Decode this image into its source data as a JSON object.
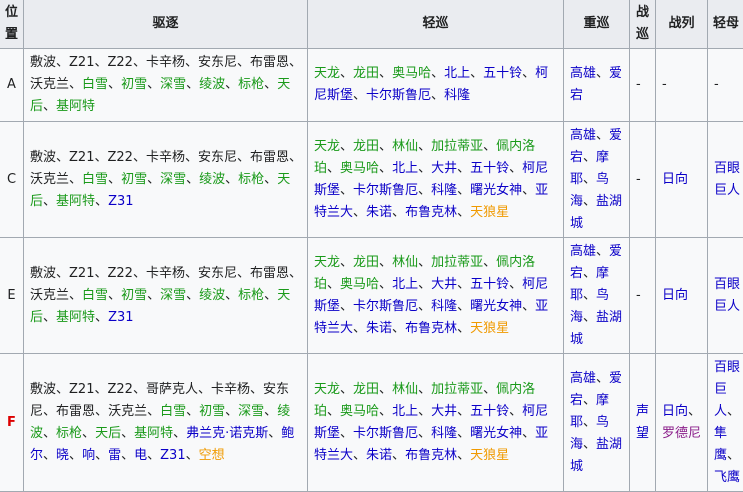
{
  "colors": {
    "black": "#202122",
    "green": "#1a9a1a",
    "blue": "#0b00c8",
    "orange": "#f09a00",
    "purple": "#8a1e8a",
    "red": "#dd0000"
  },
  "headers": [
    "位置",
    "驱逐",
    "轻巡",
    "重巡",
    "战巡",
    "战列",
    "轻母"
  ],
  "rows": [
    {
      "position": "A",
      "position_color": "black",
      "destroyers": [
        {
          "t": "敷波",
          "c": "black"
        },
        {
          "t": "Z21",
          "c": "black"
        },
        {
          "t": "Z22",
          "c": "black"
        },
        {
          "t": "卡辛杨",
          "c": "black"
        },
        {
          "t": "安东尼",
          "c": "black"
        },
        {
          "t": "布雷恩",
          "c": "black"
        },
        {
          "t": "沃克兰",
          "c": "black"
        },
        {
          "t": "白雪",
          "c": "green"
        },
        {
          "t": "初雪",
          "c": "green"
        },
        {
          "t": "深雪",
          "c": "green"
        },
        {
          "t": "绫波",
          "c": "green"
        },
        {
          "t": "标枪",
          "c": "green"
        },
        {
          "t": "天后",
          "c": "green"
        },
        {
          "t": "基阿特",
          "c": "green"
        }
      ],
      "light_cruisers": [
        {
          "t": "天龙",
          "c": "green"
        },
        {
          "t": "龙田",
          "c": "green"
        },
        {
          "t": "奥马哈",
          "c": "green"
        },
        {
          "t": "北上",
          "c": "blue"
        },
        {
          "t": "五十铃",
          "c": "blue"
        },
        {
          "t": "柯尼斯堡",
          "c": "blue"
        },
        {
          "t": "卡尔斯鲁厄",
          "c": "blue"
        },
        {
          "t": "科隆",
          "c": "blue"
        }
      ],
      "heavy_cruisers": [
        {
          "t": "高雄",
          "c": "blue"
        },
        {
          "t": "爱宕",
          "c": "blue"
        }
      ],
      "battlecruisers": [
        {
          "t": "-",
          "c": "black"
        }
      ],
      "battleships": [
        {
          "t": "-",
          "c": "black"
        }
      ],
      "light_carriers": [
        {
          "t": "-",
          "c": "black"
        }
      ]
    },
    {
      "position": "C",
      "position_color": "black",
      "destroyers": [
        {
          "t": "敷波",
          "c": "black"
        },
        {
          "t": "Z21",
          "c": "black"
        },
        {
          "t": "Z22",
          "c": "black"
        },
        {
          "t": "卡辛杨",
          "c": "black"
        },
        {
          "t": "安东尼",
          "c": "black"
        },
        {
          "t": "布雷恩",
          "c": "black"
        },
        {
          "t": "沃克兰",
          "c": "black"
        },
        {
          "t": "白雪",
          "c": "green"
        },
        {
          "t": "初雪",
          "c": "green"
        },
        {
          "t": "深雪",
          "c": "green"
        },
        {
          "t": "绫波",
          "c": "green"
        },
        {
          "t": "标枪",
          "c": "green"
        },
        {
          "t": "天后",
          "c": "green"
        },
        {
          "t": "基阿特",
          "c": "green"
        },
        {
          "t": "Z31",
          "c": "blue"
        }
      ],
      "light_cruisers": [
        {
          "t": "天龙",
          "c": "green"
        },
        {
          "t": "龙田",
          "c": "green"
        },
        {
          "t": "林仙",
          "c": "green"
        },
        {
          "t": "加拉蒂亚",
          "c": "green"
        },
        {
          "t": "佩内洛珀",
          "c": "green"
        },
        {
          "t": "奥马哈",
          "c": "green"
        },
        {
          "t": "北上",
          "c": "blue"
        },
        {
          "t": "大井",
          "c": "blue"
        },
        {
          "t": "五十铃",
          "c": "blue"
        },
        {
          "t": "柯尼斯堡",
          "c": "blue"
        },
        {
          "t": "卡尔斯鲁厄",
          "c": "blue"
        },
        {
          "t": "科隆",
          "c": "blue"
        },
        {
          "t": "曙光女神",
          "c": "blue"
        },
        {
          "t": "亚特兰大",
          "c": "blue"
        },
        {
          "t": "朱诺",
          "c": "blue"
        },
        {
          "t": "布鲁克林",
          "c": "blue"
        },
        {
          "t": "天狼星",
          "c": "orange"
        }
      ],
      "heavy_cruisers": [
        {
          "t": "高雄",
          "c": "blue"
        },
        {
          "t": "爱宕",
          "c": "blue"
        },
        {
          "t": "摩耶",
          "c": "blue"
        },
        {
          "t": "鸟海",
          "c": "blue"
        },
        {
          "t": "盐湖城",
          "c": "blue"
        }
      ],
      "battlecruisers": [
        {
          "t": "-",
          "c": "black"
        }
      ],
      "battleships": [
        {
          "t": "日向",
          "c": "blue"
        }
      ],
      "light_carriers": [
        {
          "t": "百眼巨人",
          "c": "blue"
        }
      ]
    },
    {
      "position": "E",
      "position_color": "black",
      "destroyers": [
        {
          "t": "敷波",
          "c": "black"
        },
        {
          "t": "Z21",
          "c": "black"
        },
        {
          "t": "Z22",
          "c": "black"
        },
        {
          "t": "卡辛杨",
          "c": "black"
        },
        {
          "t": "安东尼",
          "c": "black"
        },
        {
          "t": "布雷恩",
          "c": "black"
        },
        {
          "t": "沃克兰",
          "c": "black"
        },
        {
          "t": "白雪",
          "c": "green"
        },
        {
          "t": "初雪",
          "c": "green"
        },
        {
          "t": "深雪",
          "c": "green"
        },
        {
          "t": "绫波",
          "c": "green"
        },
        {
          "t": "标枪",
          "c": "green"
        },
        {
          "t": "天后",
          "c": "green"
        },
        {
          "t": "基阿特",
          "c": "green"
        },
        {
          "t": "Z31",
          "c": "blue"
        }
      ],
      "light_cruisers": [
        {
          "t": "天龙",
          "c": "green"
        },
        {
          "t": "龙田",
          "c": "green"
        },
        {
          "t": "林仙",
          "c": "green"
        },
        {
          "t": "加拉蒂亚",
          "c": "green"
        },
        {
          "t": "佩内洛珀",
          "c": "green"
        },
        {
          "t": "奥马哈",
          "c": "green"
        },
        {
          "t": "北上",
          "c": "blue"
        },
        {
          "t": "大井",
          "c": "blue"
        },
        {
          "t": "五十铃",
          "c": "blue"
        },
        {
          "t": "柯尼斯堡",
          "c": "blue"
        },
        {
          "t": "卡尔斯鲁厄",
          "c": "blue"
        },
        {
          "t": "科隆",
          "c": "blue"
        },
        {
          "t": "曙光女神",
          "c": "blue"
        },
        {
          "t": "亚特兰大",
          "c": "blue"
        },
        {
          "t": "朱诺",
          "c": "blue"
        },
        {
          "t": "布鲁克林",
          "c": "blue"
        },
        {
          "t": "天狼星",
          "c": "orange"
        }
      ],
      "heavy_cruisers": [
        {
          "t": "高雄",
          "c": "blue"
        },
        {
          "t": "爱宕",
          "c": "blue"
        },
        {
          "t": "摩耶",
          "c": "blue"
        },
        {
          "t": "鸟海",
          "c": "blue"
        },
        {
          "t": "盐湖城",
          "c": "blue"
        }
      ],
      "battlecruisers": [
        {
          "t": "-",
          "c": "black"
        }
      ],
      "battleships": [
        {
          "t": "日向",
          "c": "blue"
        }
      ],
      "light_carriers": [
        {
          "t": "百眼巨人",
          "c": "blue"
        }
      ]
    },
    {
      "position": "F",
      "position_color": "red",
      "destroyers": [
        {
          "t": "敷波",
          "c": "black"
        },
        {
          "t": "Z21",
          "c": "black"
        },
        {
          "t": "Z22",
          "c": "black"
        },
        {
          "t": "哥萨克人",
          "c": "black"
        },
        {
          "t": "卡辛杨",
          "c": "black"
        },
        {
          "t": "安东尼",
          "c": "black"
        },
        {
          "t": "布雷恩",
          "c": "black"
        },
        {
          "t": "沃克兰",
          "c": "black"
        },
        {
          "t": "白雪",
          "c": "green"
        },
        {
          "t": "初雪",
          "c": "green"
        },
        {
          "t": "深雪",
          "c": "green"
        },
        {
          "t": "绫波",
          "c": "green"
        },
        {
          "t": "标枪",
          "c": "green"
        },
        {
          "t": "天后",
          "c": "green"
        },
        {
          "t": "基阿特",
          "c": "green"
        },
        {
          "t": "弗兰克·诺克斯",
          "c": "blue"
        },
        {
          "t": "鲍尔",
          "c": "blue"
        },
        {
          "t": "晓",
          "c": "blue"
        },
        {
          "t": "响",
          "c": "blue"
        },
        {
          "t": "雷",
          "c": "blue"
        },
        {
          "t": "电",
          "c": "blue"
        },
        {
          "t": "Z31",
          "c": "blue"
        },
        {
          "t": "空想",
          "c": "orange"
        }
      ],
      "light_cruisers": [
        {
          "t": "天龙",
          "c": "green"
        },
        {
          "t": "龙田",
          "c": "green"
        },
        {
          "t": "林仙",
          "c": "green"
        },
        {
          "t": "加拉蒂亚",
          "c": "green"
        },
        {
          "t": "佩内洛珀",
          "c": "green"
        },
        {
          "t": "奥马哈",
          "c": "green"
        },
        {
          "t": "北上",
          "c": "blue"
        },
        {
          "t": "大井",
          "c": "blue"
        },
        {
          "t": "五十铃",
          "c": "blue"
        },
        {
          "t": "柯尼斯堡",
          "c": "blue"
        },
        {
          "t": "卡尔斯鲁厄",
          "c": "blue"
        },
        {
          "t": "科隆",
          "c": "blue"
        },
        {
          "t": "曙光女神",
          "c": "blue"
        },
        {
          "t": "亚特兰大",
          "c": "blue"
        },
        {
          "t": "朱诺",
          "c": "blue"
        },
        {
          "t": "布鲁克林",
          "c": "blue"
        },
        {
          "t": "天狼星",
          "c": "orange"
        }
      ],
      "heavy_cruisers": [
        {
          "t": "高雄",
          "c": "blue"
        },
        {
          "t": "爱宕",
          "c": "blue"
        },
        {
          "t": "摩耶",
          "c": "blue"
        },
        {
          "t": "鸟海",
          "c": "blue"
        },
        {
          "t": "盐湖城",
          "c": "blue"
        }
      ],
      "battlecruisers": [
        {
          "t": "声望",
          "c": "blue"
        }
      ],
      "battleships": [
        {
          "t": "日向",
          "c": "blue"
        },
        {
          "t": "罗德尼",
          "c": "purple"
        }
      ],
      "light_carriers": [
        {
          "t": "百眼巨人",
          "c": "blue"
        },
        {
          "t": "隼鹰",
          "c": "blue"
        },
        {
          "t": "飞鹰",
          "c": "blue"
        }
      ]
    }
  ]
}
